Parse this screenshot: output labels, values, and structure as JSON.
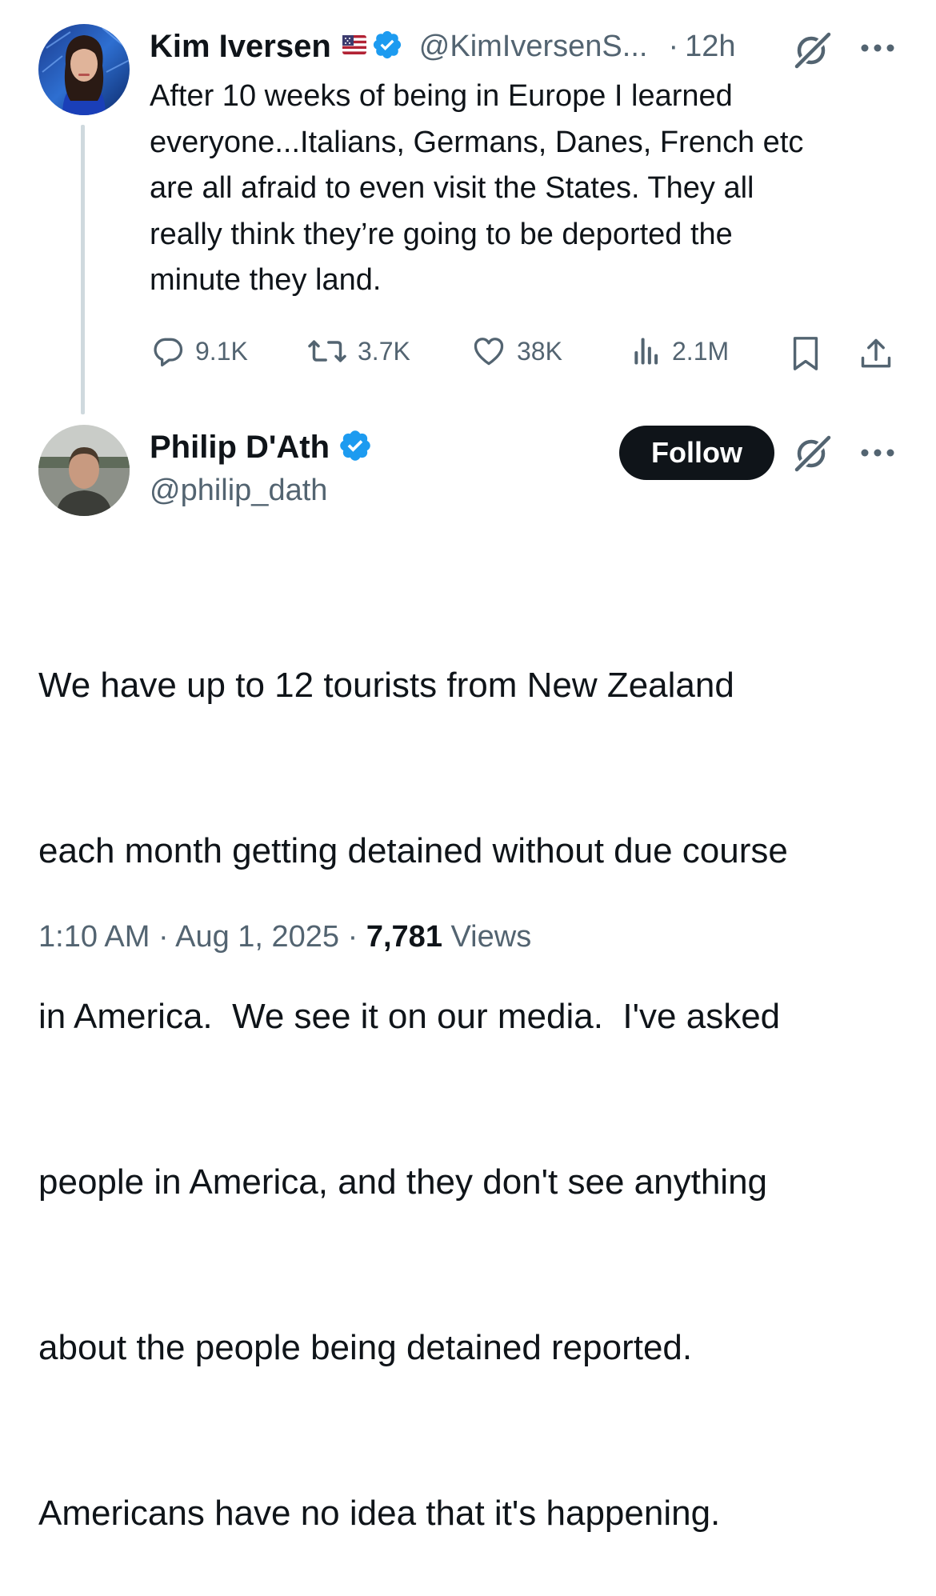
{
  "parent_tweet": {
    "author_name": "Kim Iversen",
    "flag_icon": "us-flag-icon",
    "verified": true,
    "handle": "@KimIversenS...",
    "separator": "·",
    "time": "12h",
    "text_lines": [
      "After 10 weeks of being in Europe I learned",
      "everyone...Italians, Germans, Danes, French etc",
      "are all afraid to even visit the States. They all",
      "really think they’re going to be deported the",
      "minute they land."
    ],
    "stats": {
      "replies": "9.1K",
      "reposts": "3.7K",
      "likes": "38K",
      "views": "2.1M"
    }
  },
  "reply_tweet": {
    "author_name": "Philip D'Ath",
    "verified": true,
    "handle": "@philip_dath",
    "follow_label": "Follow",
    "text_lines": [
      "We have up to 12 tourists from New Zealand",
      "each month getting detained without due course",
      "in America.  We see it on our media.  I've asked",
      "people in America, and they don't see anything",
      "about the people being detained reported.",
      "Americans have no idea that it's happening."
    ],
    "time": "1:10 AM",
    "dot1": "·",
    "date": "Aug 1, 2025",
    "dot2": "·",
    "views_count": "7,781",
    "views_label": "Views"
  },
  "colors": {
    "text": "#0f1419",
    "secondary": "#536471",
    "verified_blue": "#1d9bf0",
    "thread_line": "#cfd9de"
  }
}
